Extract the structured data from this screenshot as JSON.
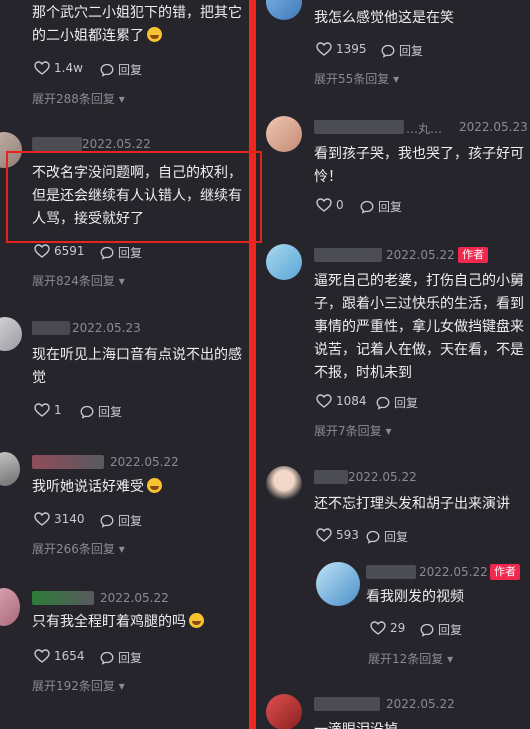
{
  "left_comments": [
    {
      "text": "那个武穴二小姐犯下的错，把其它的二小姐都连累了",
      "emoji": true,
      "likes": "1.4w",
      "reply": "回复",
      "expand": "展开288条回复"
    },
    {
      "date": "2022.05.22",
      "text": "不改名字没问题啊，自己的权利，但是还会继续有人认错人，继续有人骂，接受就好了",
      "likes": "6591",
      "reply": "回复",
      "expand": "展开824条回复"
    },
    {
      "date": "2022.05.23",
      "text": "现在听见上海口音有点说不出的感觉",
      "likes": "1",
      "reply": "回复"
    },
    {
      "date": "2022.05.22",
      "text": "我听她说话好难受",
      "emoji": true,
      "likes": "3140",
      "reply": "回复",
      "expand": "展开266条回复"
    },
    {
      "date": "2022.05.22",
      "text": "只有我全程盯着鸡腿的吗",
      "emoji": true,
      "likes": "1654",
      "reply": "回复",
      "expand": "展开192条回复"
    }
  ],
  "right_comments": [
    {
      "text": "我怎么感觉他这是在笑",
      "likes": "1395",
      "reply": "回复",
      "expand": "展开55条回复"
    },
    {
      "username_fragment": "…丸…",
      "date": "2022.05.23",
      "text": "看到孩子哭，我也哭了，孩子好可怜！",
      "likes": "0",
      "reply": "回复"
    },
    {
      "date": "2022.05.22",
      "tag": "作者",
      "text": "逼死自己的老婆，打伤自己的小舅子，跟着小三过快乐的生活，看到事情的严重性，拿儿女做挡键盘来说苦，记着人在做，天在看，不是不报，时机未到",
      "likes": "1084",
      "reply": "回复",
      "expand": "展开7条回复"
    },
    {
      "date": "2022.05.22",
      "text": "还不忘打理头发和胡子出来演讲",
      "likes": "593",
      "reply": "回复"
    },
    {
      "date": "2022.05.22",
      "tag": "作者",
      "text": "看我刚发的视频",
      "likes": "29",
      "reply": "回复",
      "expand": "展开12条回复"
    },
    {
      "date": "2022.05.22",
      "text": "一滴眼泪没掉"
    }
  ],
  "colors": {
    "divider": "#f0261e",
    "highlight": "#e8221c",
    "author_tag": "#f0284e",
    "background": "#25252b"
  },
  "icons": [
    "heart-icon",
    "reply-bubble-icon",
    "chevron-down-icon",
    "laughing-emoji-icon"
  ]
}
